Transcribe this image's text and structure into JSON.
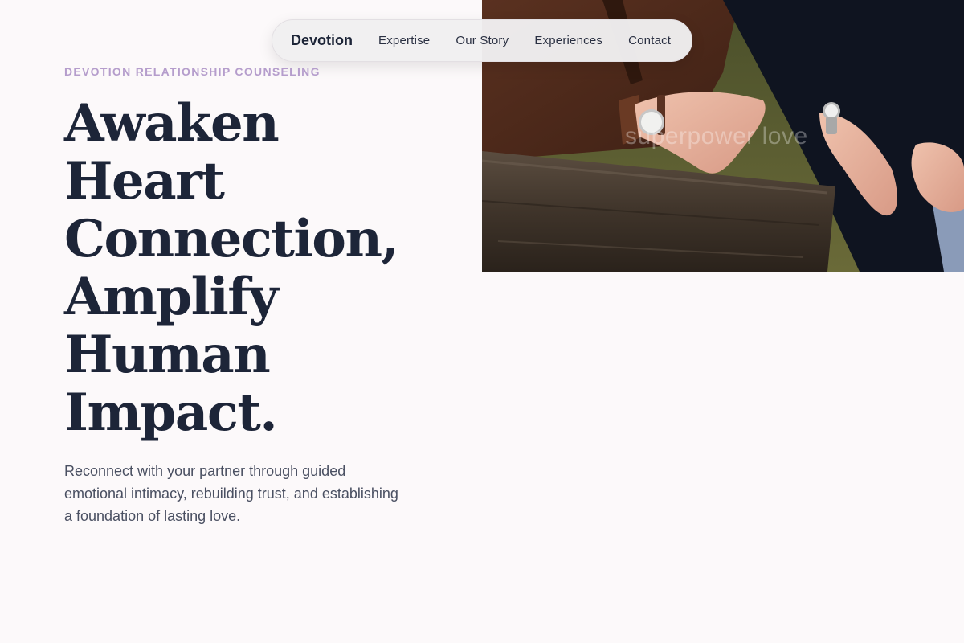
{
  "nav": {
    "brand": "Devotion",
    "links": [
      {
        "label": "Expertise"
      },
      {
        "label": "Our Story"
      },
      {
        "label": "Experiences"
      },
      {
        "label": "Contact"
      }
    ]
  },
  "hero": {
    "eyebrow": "DEVOTION RELATIONSHIP COUNSELING",
    "headline_lines": [
      "Awaken",
      "Heart",
      "Connection,",
      "Amplify",
      "Human",
      "Impact."
    ],
    "lead": "Reconnect with your partner through guided emotional intimacy, rebuilding trust, and establishing a foundation of lasting love.",
    "image_overlay_text": "superpower love"
  },
  "colors": {
    "background": "#fcf9fa",
    "heading": "#1d2538",
    "accent": "#b59dcc",
    "body_text": "#4a5062"
  }
}
